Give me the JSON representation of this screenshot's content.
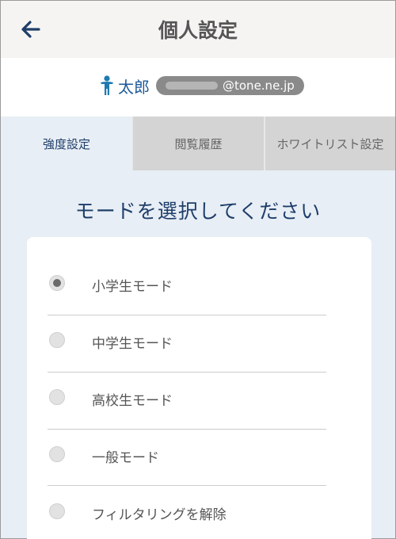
{
  "header": {
    "back_icon": "arrow-left-icon",
    "title": "個人設定"
  },
  "user": {
    "icon": "person-icon",
    "name": "太郎",
    "email_domain": "@tone.ne.jp"
  },
  "tabs": [
    {
      "label": "強度設定",
      "active": true
    },
    {
      "label": "閲覧履歴",
      "active": false
    },
    {
      "label": "ホワイトリスト設定",
      "active": false
    }
  ],
  "section_title": "モードを選択してください",
  "options": [
    {
      "label": "小学生モード",
      "selected": true
    },
    {
      "label": "中学生モード",
      "selected": false
    },
    {
      "label": "高校生モード",
      "selected": false
    },
    {
      "label": "一般モード",
      "selected": false
    },
    {
      "label": "フィルタリングを解除",
      "selected": false
    }
  ],
  "colors": {
    "accent": "#1e5a9a",
    "heading": "#1e3e6a",
    "background": "#e8eef5"
  }
}
